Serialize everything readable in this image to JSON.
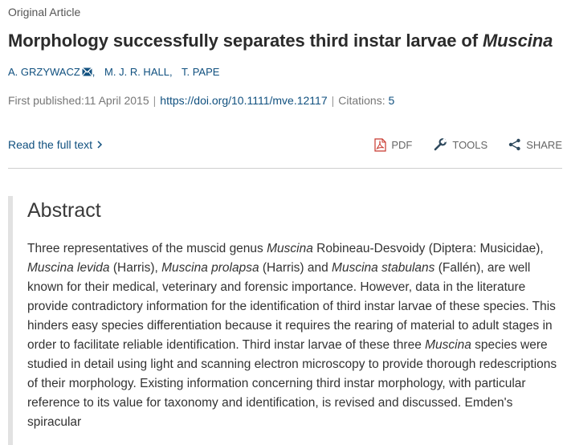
{
  "article_type": "Original Article",
  "title": {
    "main": "Morphology successfully separates third instar larvae of ",
    "italic": "Muscina"
  },
  "authors": [
    "A. GRZYWACZ",
    "M. J. R. HALL,",
    "T. PAPE"
  ],
  "meta": {
    "published_label": "First published:",
    "published_date": "11 April 2015",
    "separator": "|",
    "doi": "https://doi.org/10.1111/mve.12117",
    "citations_label": "Citations:",
    "citations_count": "5"
  },
  "read_full_text": "Read the full text",
  "toolbar": {
    "pdf": "PDF",
    "tools": "TOOLS",
    "share": "SHARE"
  },
  "abstract": {
    "heading": "Abstract",
    "segments": [
      "Three representatives of the muscid genus ",
      "Muscina",
      " Robineau-Desvoidy (Diptera: Musicidae), ",
      "Muscina levida",
      " (Harris), ",
      "Muscina prolapsa",
      " (Harris) and ",
      "Muscina stabulans",
      " (Fallén), are well known for their medical, veterinary and forensic importance. However, data in the literature provide contradictory information for the identification of third instar larvae of these species. This hinders easy species differentiation because it requires the rearing of material to adult stages in order to facilitate reliable identification. Third instar larvae of these three ",
      "Muscina",
      " species were studied in detail using light and scanning electron microscopy to provide thorough redescriptions of their morphology. Existing information concerning third instar morphology, with particular reference to its value for taxonomy and identification, is revised and discussed. Emden's spiracular"
    ]
  },
  "colors": {
    "link": "#10507f",
    "pdf_icon": "#c8372d",
    "divider": "#cfcfcf"
  },
  "icons": [
    "mail-icon",
    "chevron-right-icon",
    "pdf-icon",
    "wrench-icon",
    "share-icon"
  ]
}
